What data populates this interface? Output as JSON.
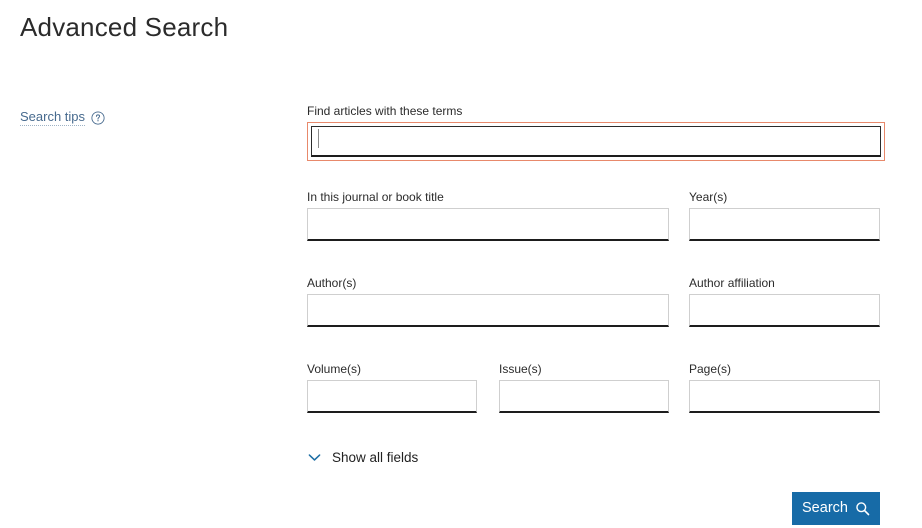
{
  "page": {
    "title": "Advanced Search"
  },
  "search_tips": {
    "label": "Search tips",
    "help_icon": "question-circle-icon",
    "link_color": "#476a8e"
  },
  "form": {
    "rows": [
      {
        "fields": [
          {
            "label": "Find articles with these terms",
            "value": "",
            "placeholder": "",
            "focused": true
          }
        ]
      },
      {
        "fields": [
          {
            "label": "In this journal or book title",
            "value": "",
            "placeholder": "",
            "focused": false
          },
          {
            "label": "Year(s)",
            "value": "",
            "placeholder": "",
            "focused": false
          }
        ]
      },
      {
        "fields": [
          {
            "label": "Author(s)",
            "value": "",
            "placeholder": "",
            "focused": false
          },
          {
            "label": "Author affiliation",
            "value": "",
            "placeholder": "",
            "focused": false
          }
        ]
      },
      {
        "fields": [
          {
            "label": "Volume(s)",
            "value": "",
            "placeholder": "",
            "focused": false
          },
          {
            "label": "Issue(s)",
            "value": "",
            "placeholder": "",
            "focused": false
          },
          {
            "label": "Page(s)",
            "value": "",
            "placeholder": "",
            "focused": false
          }
        ]
      }
    ]
  },
  "show_all_fields": {
    "label": "Show all fields",
    "icon": "chevron-down-icon",
    "expanded": false,
    "icon_color": "#1c6ea4"
  },
  "search_button": {
    "label": "Search",
    "icon": "magnifier-icon",
    "background": "#176ba7",
    "text_color": "#ffffff"
  },
  "colors": {
    "focus_ring": "#e8896b",
    "accent_blue": "#176ba7",
    "input_border": "#cfcfcf",
    "input_underline": "#1d1d1d",
    "text": "#1a1a1a"
  }
}
